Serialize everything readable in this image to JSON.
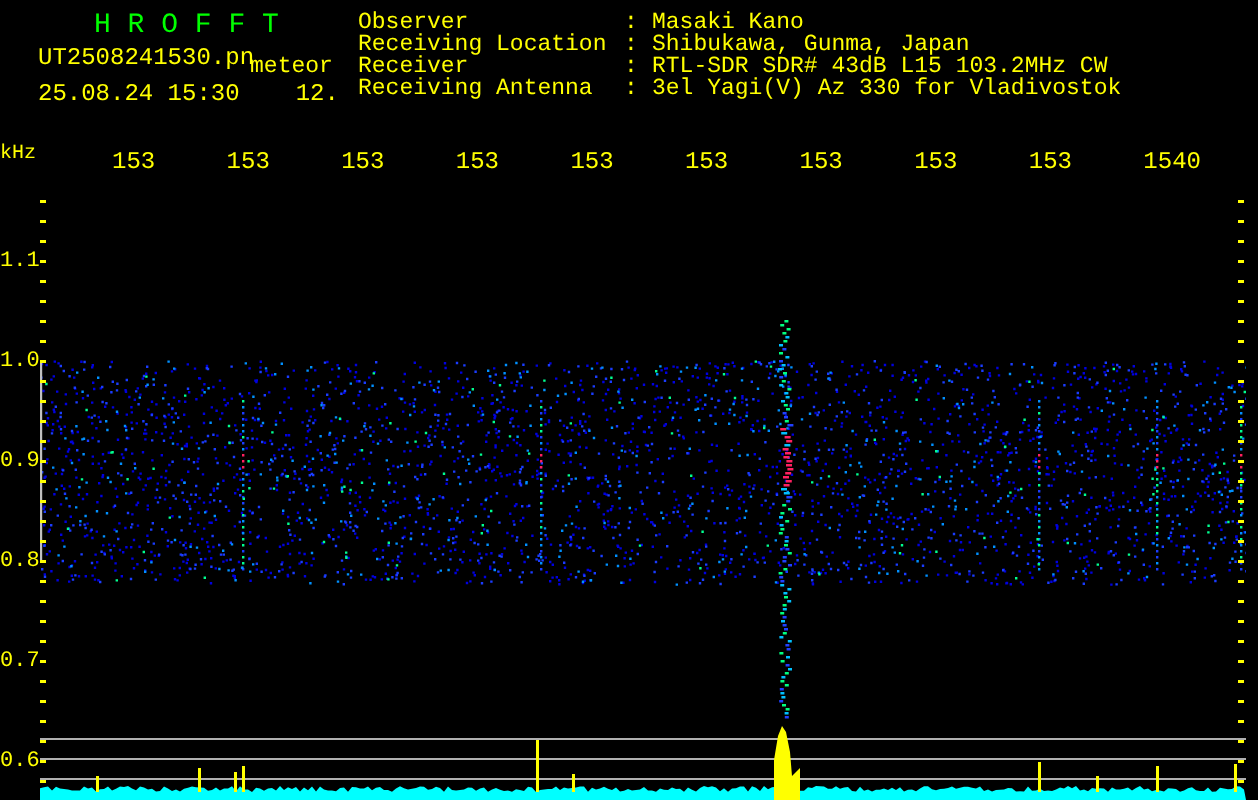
{
  "header": {
    "logo": "H R O F F T",
    "filename": "UT2508241530.pn",
    "mode": "meteor",
    "timestamp": "25.08.24 15:30",
    "count": "12."
  },
  "station": [
    {
      "label": "Observer",
      "separator": ":",
      "value": "Masaki Kano"
    },
    {
      "label": "Receiving Location",
      "separator": ":",
      "value": "Shibukawa, Gunma, Japan"
    },
    {
      "label": "Receiver",
      "separator": ":",
      "value": "RTL-SDR SDR# 43dB L15 103.2MHz CW"
    },
    {
      "label": "Receiving Antenna",
      "separator": ":",
      "value": "3el Yagi(V) Az 330 for Vladivostok"
    }
  ],
  "frequency_axis": {
    "unit": "kHz",
    "ticks": [
      "153",
      "153",
      "153",
      "153",
      "153",
      "153",
      "153",
      "153",
      "153",
      "1540"
    ]
  },
  "amplitude_axis": {
    "ticks": [
      "1.1",
      "1.0",
      "0.9",
      "0.8",
      "0.7",
      "0.6"
    ]
  }
}
